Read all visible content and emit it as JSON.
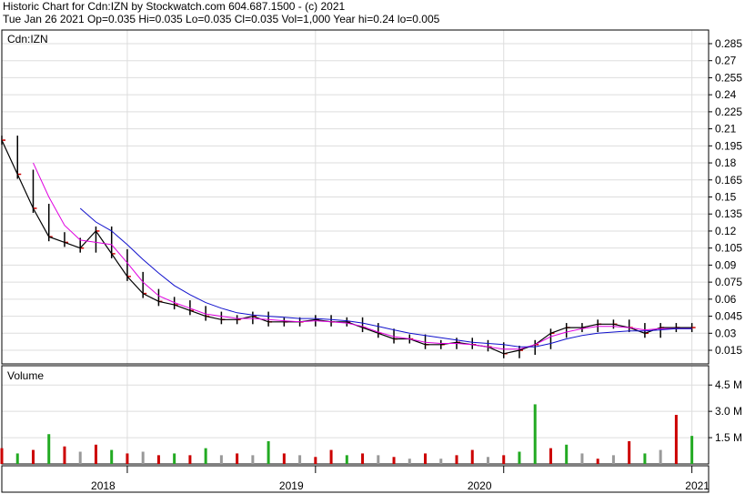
{
  "header": {
    "line1": "Historic Chart for Cdn:IZN by Stockwatch.com 604.687.1500 - (c) 2021",
    "line2": "Tue Jan 26 2021   Op=0.035  Hi=0.035  Lo=0.035  Cl=0.035  Vol=1,000   Year hi=0.24  lo=0.005"
  },
  "colors": {
    "price_bar": "#000000",
    "ma_short": "#e000e0",
    "ma_long": "#1010cc",
    "close_tick_red": "#cc0000",
    "vol_up": "#22aa22",
    "vol_down": "#cc0000",
    "vol_flat": "#999999",
    "grid": "#dddddd"
  },
  "chart_data": [
    {
      "type": "line",
      "label": "Cdn:IZN",
      "grid": true,
      "ylim": [
        0.003,
        0.297
      ],
      "y_ticks": [
        "0.285",
        "0.27",
        "0.255",
        "0.24",
        "0.225",
        "0.21",
        "0.195",
        "0.18",
        "0.165",
        "0.15",
        "0.135",
        "0.12",
        "0.105",
        "0.09",
        "0.075",
        "0.06",
        "0.045",
        "0.03",
        "0.015"
      ],
      "x_labels": [
        "2018",
        "2019",
        "2020",
        "2021"
      ],
      "x_range": [
        "2017-05",
        "2021-01-26"
      ],
      "series": [
        {
          "key": "price",
          "x": [
            "2017-05",
            "2017-06",
            "2017-07",
            "2017-08",
            "2017-09",
            "2017-10",
            "2017-11",
            "2017-12",
            "2018-01",
            "2018-02",
            "2018-03",
            "2018-04",
            "2018-05",
            "2018-06",
            "2018-07",
            "2018-08",
            "2018-09",
            "2018-10",
            "2018-11",
            "2018-12",
            "2019-01",
            "2019-02",
            "2019-03",
            "2019-04",
            "2019-05",
            "2019-06",
            "2019-07",
            "2019-08",
            "2019-09",
            "2019-10",
            "2019-11",
            "2019-12",
            "2020-01",
            "2020-02",
            "2020-03",
            "2020-04",
            "2020-05",
            "2020-06",
            "2020-07",
            "2020-08",
            "2020-09",
            "2020-10",
            "2020-11",
            "2020-12",
            "2021-01"
          ],
          "values": [
            0.2,
            0.17,
            0.14,
            0.115,
            0.11,
            0.105,
            0.12,
            0.1,
            0.08,
            0.065,
            0.058,
            0.055,
            0.05,
            0.045,
            0.042,
            0.042,
            0.045,
            0.04,
            0.04,
            0.04,
            0.042,
            0.04,
            0.04,
            0.035,
            0.03,
            0.025,
            0.025,
            0.02,
            0.02,
            0.022,
            0.02,
            0.018,
            0.012,
            0.015,
            0.02,
            0.03,
            0.035,
            0.035,
            0.038,
            0.038,
            0.035,
            0.03,
            0.035,
            0.035,
            0.035
          ]
        },
        {
          "key": "ma_short",
          "x": [
            "2017-07",
            "2017-08",
            "2017-09",
            "2017-10",
            "2017-11",
            "2017-12",
            "2018-01",
            "2018-02",
            "2018-03",
            "2018-04",
            "2018-05",
            "2018-06",
            "2018-07",
            "2018-08",
            "2018-09",
            "2018-10",
            "2018-11",
            "2018-12",
            "2019-01",
            "2019-02",
            "2019-03",
            "2019-04",
            "2019-05",
            "2019-06",
            "2019-07",
            "2019-08",
            "2019-09",
            "2019-10",
            "2019-11",
            "2019-12",
            "2020-01",
            "2020-02",
            "2020-03",
            "2020-04",
            "2020-05",
            "2020-06",
            "2020-07",
            "2020-08",
            "2020-09",
            "2020-10",
            "2020-11",
            "2020-12",
            "2021-01"
          ],
          "values": [
            0.18,
            0.15,
            0.125,
            0.112,
            0.11,
            0.108,
            0.092,
            0.075,
            0.063,
            0.057,
            0.052,
            0.047,
            0.045,
            0.043,
            0.043,
            0.042,
            0.041,
            0.04,
            0.041,
            0.04,
            0.039,
            0.036,
            0.031,
            0.027,
            0.025,
            0.022,
            0.021,
            0.021,
            0.02,
            0.018,
            0.016,
            0.016,
            0.02,
            0.027,
            0.031,
            0.034,
            0.036,
            0.036,
            0.035,
            0.033,
            0.034,
            0.034,
            0.034
          ]
        },
        {
          "key": "ma_long",
          "x": [
            "2017-10",
            "2017-11",
            "2017-12",
            "2018-01",
            "2018-02",
            "2018-03",
            "2018-04",
            "2018-05",
            "2018-06",
            "2018-07",
            "2018-08",
            "2018-09",
            "2018-10",
            "2018-11",
            "2018-12",
            "2019-01",
            "2019-02",
            "2019-03",
            "2019-04",
            "2019-05",
            "2019-06",
            "2019-07",
            "2019-08",
            "2019-09",
            "2019-10",
            "2019-11",
            "2019-12",
            "2020-01",
            "2020-02",
            "2020-03",
            "2020-04",
            "2020-05",
            "2020-06",
            "2020-07",
            "2020-08",
            "2020-09",
            "2020-10",
            "2020-11",
            "2020-12",
            "2021-01"
          ],
          "values": [
            0.14,
            0.128,
            0.12,
            0.108,
            0.095,
            0.083,
            0.072,
            0.064,
            0.057,
            0.052,
            0.048,
            0.046,
            0.045,
            0.044,
            0.043,
            0.043,
            0.042,
            0.041,
            0.039,
            0.036,
            0.033,
            0.03,
            0.028,
            0.026,
            0.024,
            0.022,
            0.021,
            0.02,
            0.018,
            0.018,
            0.021,
            0.025,
            0.028,
            0.03,
            0.031,
            0.032,
            0.032,
            0.033,
            0.034,
            0.034
          ]
        }
      ]
    },
    {
      "type": "bar",
      "label": "Volume",
      "ylim": [
        0,
        5.6
      ],
      "y_ticks": [
        "4.5 M",
        "3.0 M",
        "1.5 M"
      ],
      "x": [
        "2017-05",
        "2017-06",
        "2017-07",
        "2017-08",
        "2017-09",
        "2017-10",
        "2017-11",
        "2017-12",
        "2018-01",
        "2018-02",
        "2018-03",
        "2018-04",
        "2018-05",
        "2018-06",
        "2018-07",
        "2018-08",
        "2018-09",
        "2018-10",
        "2018-11",
        "2018-12",
        "2019-01",
        "2019-02",
        "2019-03",
        "2019-04",
        "2019-05",
        "2019-06",
        "2019-07",
        "2019-08",
        "2019-09",
        "2019-10",
        "2019-11",
        "2019-12",
        "2020-01",
        "2020-02",
        "2020-03",
        "2020-04",
        "2020-05",
        "2020-06",
        "2020-07",
        "2020-08",
        "2020-09",
        "2020-10",
        "2020-11",
        "2020-12",
        "2021-01"
      ],
      "values": [
        0.9,
        0.6,
        0.8,
        1.7,
        1.0,
        0.7,
        1.1,
        0.8,
        0.6,
        0.7,
        0.5,
        0.6,
        0.5,
        0.9,
        0.5,
        0.6,
        0.5,
        1.3,
        0.6,
        0.5,
        0.4,
        0.8,
        0.5,
        0.6,
        0.5,
        0.4,
        0.3,
        0.6,
        0.3,
        0.5,
        0.8,
        0.4,
        0.5,
        0.7,
        3.4,
        0.9,
        1.1,
        0.6,
        0.3,
        0.5,
        1.3,
        0.6,
        0.8,
        2.8,
        1.6
      ],
      "colors": [
        "r",
        "g",
        "r",
        "g",
        "r",
        "gr",
        "r",
        "g",
        "r",
        "gr",
        "r",
        "g",
        "r",
        "g",
        "gr",
        "r",
        "gr",
        "g",
        "r",
        "gr",
        "r",
        "r",
        "g",
        "r",
        "gr",
        "r",
        "gr",
        "r",
        "gr",
        "r",
        "r",
        "gr",
        "r",
        "g",
        "g",
        "r",
        "g",
        "gr",
        "r",
        "gr",
        "r",
        "g",
        "gr",
        "r",
        "g"
      ]
    }
  ]
}
